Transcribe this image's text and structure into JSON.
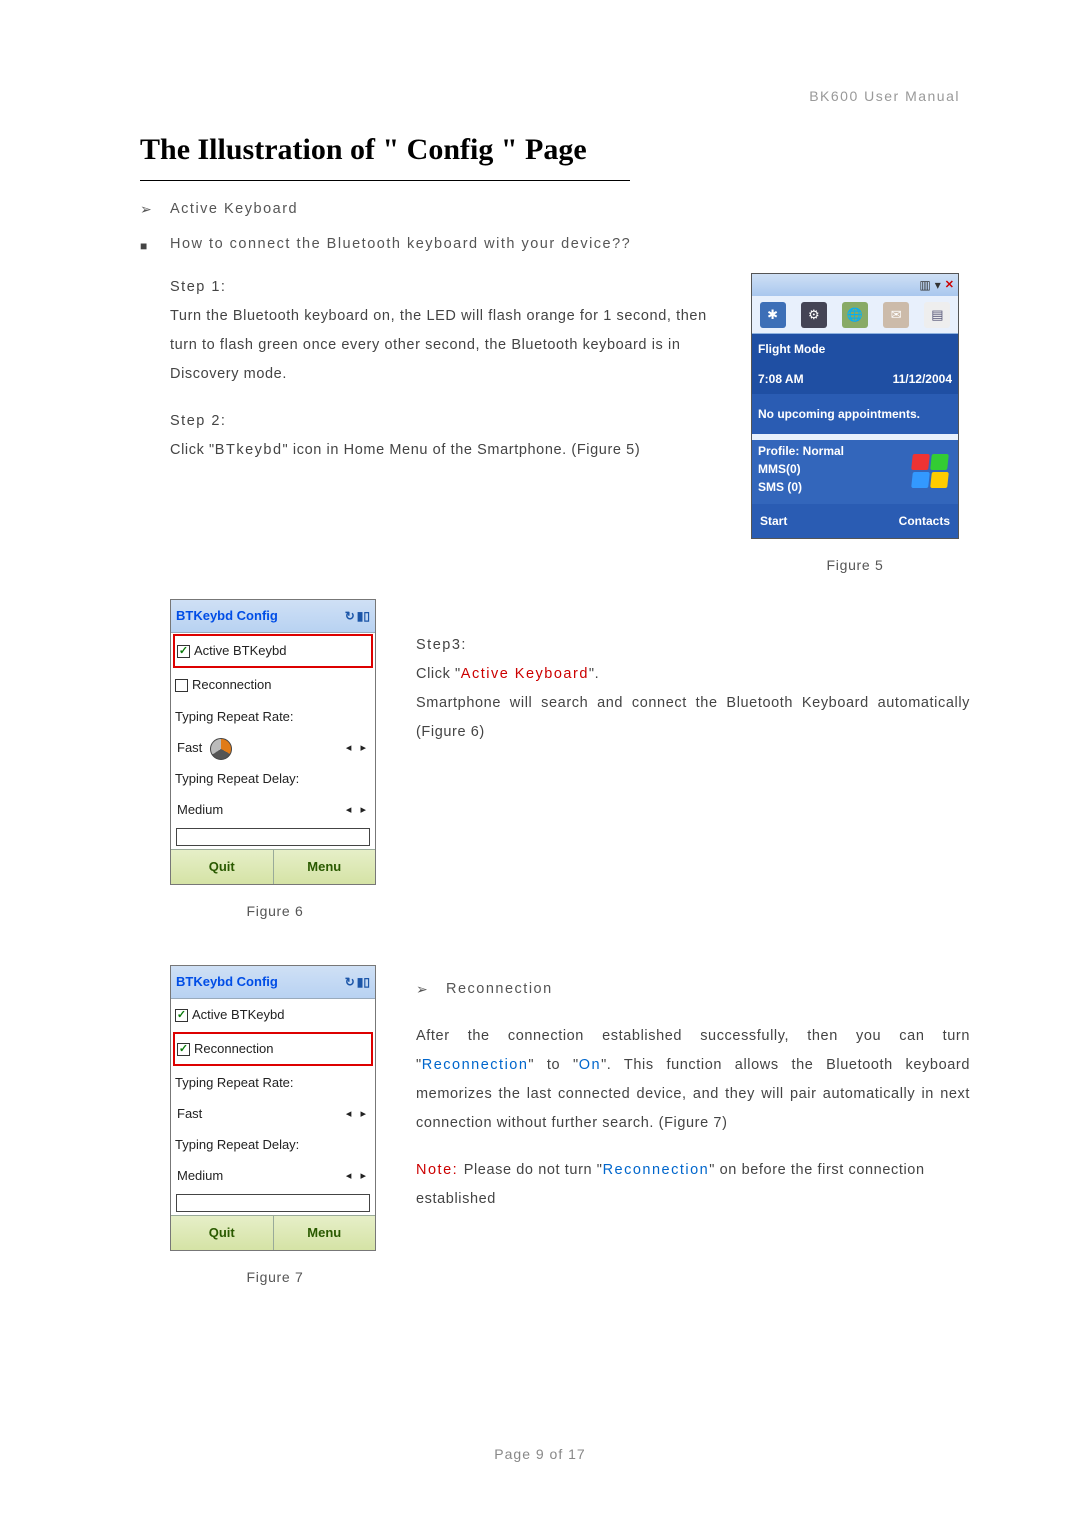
{
  "header": {
    "manual": "BK600 User Manual"
  },
  "title": "The Illustration of \" Config \" Page",
  "bullets": {
    "active_keyboard": "Active Keyboard",
    "howto": "How to connect the Bluetooth keyboard with your device??",
    "reconnection": "Reconnection"
  },
  "steps": {
    "s1_label": "Step 1:",
    "s1_body": "Turn the Bluetooth keyboard on, the LED will flash orange for 1 second, then turn to flash green once every other second, the Bluetooth keyboard is in Discovery mode.",
    "s2_label": "Step 2:",
    "s2_body_a": "Click \"",
    "s2_body_b": "BTkeybd",
    "s2_body_c": "\" icon in Home Menu of the Smartphone.   (Figure 5)",
    "s3_label": "Step3:",
    "s3_click": "Click \"",
    "s3_link": "Active Keyboard",
    "s3_close": "\".",
    "s3_body": "Smartphone will search and connect the Bluetooth Keyboard automatically (Figure 6)"
  },
  "reconn": {
    "p1_a": "After the connection established successfully, then you can turn \"",
    "p1_link": "Reconnection",
    "p1_b": "\" to \"",
    "p1_on": "On",
    "p1_c": "\". This function allows the Bluetooth keyboard memorizes the last connected device, and they will pair automatically in next connection without further search. (Figure 7)",
    "note_label": "Note: ",
    "note_a": "Please do not turn \"",
    "note_link": "Reconnection",
    "note_b": "\" on before the first connection established"
  },
  "fig": {
    "f5": "Figure 5",
    "f6": "Figure 6",
    "f7": "Figure 7"
  },
  "phone": {
    "flight": "Flight Mode",
    "time": "7:08 AM",
    "date": "11/12/2004",
    "noappt": "No upcoming appointments.",
    "profile": "Profile: Normal",
    "mms": "MMS(0)",
    "sms": "SMS (0)",
    "start": "Start",
    "contacts": "Contacts"
  },
  "cfg": {
    "title": "BTKeybd Config",
    "active": "Active BTKeybd",
    "reconn": "Reconnection",
    "rate_label": "Typing Repeat Rate:",
    "rate_value": "Fast",
    "delay_label": "Typing Repeat Delay:",
    "delay_value": "Medium",
    "quit": "Quit",
    "menu": "Menu"
  },
  "footer": {
    "page": "Page 9 of 17"
  }
}
